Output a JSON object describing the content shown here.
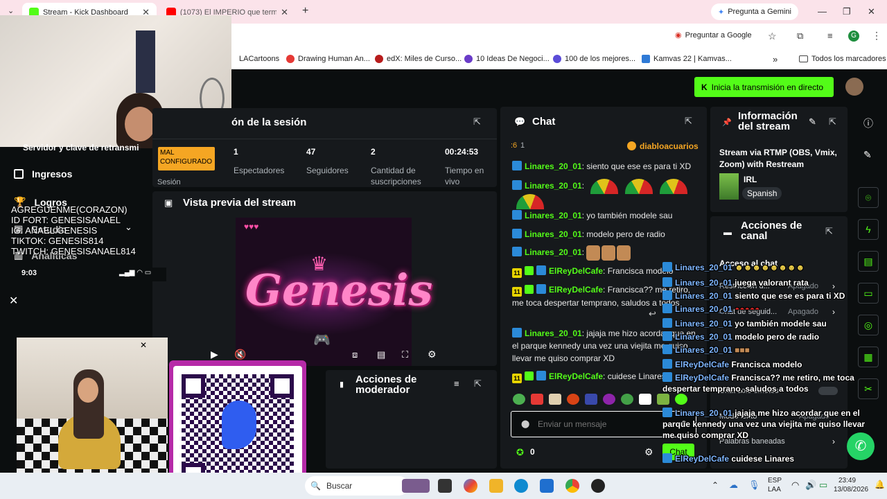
{
  "browser": {
    "tabs": [
      {
        "title": "Stream - Kick Dashboard"
      },
      {
        "title": "(1073) El IMPERIO que terminó"
      }
    ],
    "new_tab": "+",
    "gemini": "Pregunta a Gemini",
    "ask_google": "Preguntar a Google",
    "bookmarks": [
      "LACartoons",
      "Drawing Human An...",
      "edX: Miles de Curso...",
      "10 Ideas De Negoci...",
      "100 de los mejores...",
      "Kamvas 22 | Kamvas..."
    ],
    "all_bookmarks": "Todos los marcadores",
    "more_bookmarks": "»"
  },
  "header": {
    "live_button": "Inicia la transmisión en directo"
  },
  "session": {
    "title": "ón de la sesión",
    "server_key_label": "Servidor y clave de retransmi",
    "status_badge": "MAL CONFIGURADO",
    "session_label": "Sesión",
    "stats": [
      {
        "value": "1",
        "label": "Espectadores"
      },
      {
        "value": "47",
        "label": "Seguidores"
      },
      {
        "value": "2",
        "label": "Cantidad de suscripciones"
      },
      {
        "value": "00:24:53",
        "label": "Tiempo en vivo"
      }
    ]
  },
  "sidebar": {
    "items": [
      {
        "label": "Ingresos"
      },
      {
        "label": "Logros"
      },
      {
        "label": "Estudio"
      },
      {
        "label": "Analíticas"
      }
    ]
  },
  "overlay_text": {
    "lines": [
      "AGREGUENME(CORAZON)",
      "ID FORT: GENESISANAEL",
      "IG: ANAEL.GENESIS",
      "TIKTOK: GENESIS814",
      "TWITCH: GENESISANAEL814"
    ],
    "phone_time": "9:03"
  },
  "preview": {
    "title": "Vista previa del stream",
    "logo_text": "Genesis"
  },
  "mod_actions": {
    "title": "Acciones de moderador"
  },
  "chat": {
    "title": "Chat",
    "viewer_count_prefix": ":6",
    "viewer_count": "1",
    "top_user": "diabloacuarios",
    "messages": [
      {
        "user": "Linares_20_01",
        "text": "siento que ese es para ti XD"
      },
      {
        "user": "Linares_20_01",
        "text": ""
      },
      {
        "user": "Linares_20_01",
        "text": "yo también modele sau"
      },
      {
        "user": "Linares_20_01",
        "text": "modelo pero de radio"
      },
      {
        "user": "Linares_20_01",
        "text": ""
      },
      {
        "user": "ElReyDelCafe",
        "text": "Francisca modelo"
      },
      {
        "user": "ElReyDelCafe",
        "text": "Francisca?? me retiro, me toca despertar temprano, saludos a todos"
      },
      {
        "user": "Linares_20_01",
        "text": "jajaja me hizo acordar que en el parque kennedy una vez una viejita me quiso llevar me quiso comprar XD"
      },
      {
        "user": "ElReyDelCafe",
        "text": "cuidese Linares"
      }
    ],
    "input_placeholder": "Enviar un mensaje",
    "points": "0",
    "send_button": "Chat"
  },
  "stream_info": {
    "title": "Información del stream",
    "stream_title": "Stream via RTMP (OBS, Vmix, Zoom) with Restream",
    "category": "IRL",
    "language": "Spanish"
  },
  "channel_actions": {
    "title": "Acciones de canal",
    "rows": [
      {
        "label": "Acceso al chat",
        "value": ""
      },
      {
        "label": "Restricción d...",
        "value": "Apagado"
      },
      {
        "label": "Chat de seguid...",
        "value": "Apagado"
      },
      {
        "label": "Chat solo emotes",
        "value": ""
      },
      {
        "label": "Modo lento",
        "value": "Apagado"
      },
      {
        "label": "Palabras baneadas",
        "value": ""
      }
    ]
  },
  "overlay_chat": [
    {
      "user": "Linares_20_01",
      "text": ""
    },
    {
      "user": "Linares_20_01",
      "text": "juega valorant rata"
    },
    {
      "user": "Linares_20_01",
      "text": "siento que ese es para ti XD"
    },
    {
      "user": "Linares_20_01",
      "text": ""
    },
    {
      "user": "Linares_20_01",
      "text": "yo también modele sau"
    },
    {
      "user": "Linares_20_01",
      "text": "modelo pero de radio"
    },
    {
      "user": "Linares_20_01",
      "text": ""
    },
    {
      "user": "ElReyDelCafe",
      "text": "Francisca modelo"
    },
    {
      "user": "ElReyDelCafe",
      "text": "Francisca?? me retiro, me toca despertar temprano, saludos a todos"
    },
    {
      "user": "Linares_20_01",
      "text": "jajaja me hizo acordar que en el parque kennedy una vez una viejita me quiso llevar me quiso comprar XD"
    },
    {
      "user": "ElReyDelCafe",
      "text": "cuidese Linares"
    }
  ],
  "taskbar": {
    "search": "Buscar",
    "lang": "ESP",
    "lang2": "LAA",
    "time": "23:49",
    "date": "13/08/2026"
  },
  "colors": {
    "kick_green": "#53fc18",
    "panel_bg": "#16191c",
    "badge_orange": "#f5a623"
  }
}
